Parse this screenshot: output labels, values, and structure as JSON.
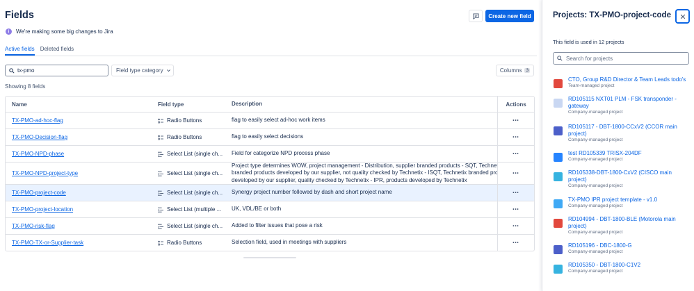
{
  "page": {
    "title": "Fields",
    "create_button": "Create new field",
    "banner": "We're making some big changes to Jira"
  },
  "tabs": [
    {
      "label": "Active fields",
      "active": true
    },
    {
      "label": "Deleted fields",
      "active": false
    }
  ],
  "filters": {
    "search_value": "tx-pmo",
    "field_type": "Field type category",
    "columns_label": "Columns",
    "columns_count": "3",
    "showing": "Showing 8 fields"
  },
  "table": {
    "headers": {
      "name": "Name",
      "type": "Field type",
      "description": "Description",
      "actions": "Actions"
    },
    "rows": [
      {
        "name": "TX-PMO-ad-hoc-flag",
        "type": "Radio Buttons",
        "icon": "radio-icon",
        "description": [
          "flag to easily select ad-hoc work items"
        ],
        "selected": false
      },
      {
        "name": "TX-PMO-Decision-flag",
        "type": "Radio Buttons",
        "icon": "radio-icon",
        "description": [
          "flag to easily select decisions"
        ],
        "selected": false
      },
      {
        "name": "TX-PMO-NPD-phase",
        "type": "Select List (single ch...",
        "icon": "select-icon",
        "description": [
          "Field for categorize NPD process phase"
        ],
        "selected": false
      },
      {
        "name": "TX-PMO-NPD-project-type",
        "type": "Select List (single ch...",
        "icon": "select-icon",
        "description": [
          "Project type determines WOW, project management - Distribution, supplier branded products - SQT, Technetix",
          "branded products developed by our supplier, not quality checked by Technetix - ISQT, Technetix branded prod",
          "developed by our supplier, quality checked by Technetix - IPR, products developed by Technetix"
        ],
        "selected": false
      },
      {
        "name": "TX-PMO-project-code",
        "type": "Select List (single ch...",
        "icon": "select-icon",
        "description": [
          "Synergy project number followed by dash and short project name"
        ],
        "selected": true
      },
      {
        "name": "TX-PMO-project-location",
        "type": "Select List (multiple ...",
        "icon": "select-icon",
        "description": [
          "UK, VDL/BE or both"
        ],
        "selected": false
      },
      {
        "name": "TX-PMO-risk-flag",
        "type": "Select List (single ch...",
        "icon": "select-icon",
        "description": [
          "Added to filter issues that pose a risk"
        ],
        "selected": false
      },
      {
        "name": "TX-PMO-TX-or-Supplier-task",
        "type": "Radio Buttons",
        "icon": "radio-icon",
        "description": [
          "Selection field, used in meetings with suppliers"
        ],
        "selected": false
      }
    ]
  },
  "panel": {
    "title": "Projects: TX-PMO-project-code",
    "info": "This field is used in 12 projects",
    "search_placeholder": "Search for projects",
    "projects": [
      {
        "name": [
          "CTO, Group R&D Director & Team Leads todo's"
        ],
        "type": "Team-managed project",
        "color": "#e2483d"
      },
      {
        "name": [
          "RD105115 NXT01 PLM - FSK transponder -",
          "gateway"
        ],
        "type": "Company-managed project",
        "color": "#c9d7f2"
      },
      {
        "name": [
          "RD105117 - DBT-1800-CCxV2 (CCOR main",
          "project)"
        ],
        "type": "Company-managed project",
        "color": "#4c5fc9"
      },
      {
        "name": [
          "test RD105339 TRISX-204DF"
        ],
        "type": "Company-managed project",
        "color": "#2684ff"
      },
      {
        "name": [
          "RD105338-DBT-1800-CxV2 (CISCO main",
          "project)"
        ],
        "type": "Company-managed project",
        "color": "#36b3e0"
      },
      {
        "name": [
          "TX-PMO IPR project template - v1.0"
        ],
        "type": "Company-managed project",
        "color": "#3fa9f5"
      },
      {
        "name": [
          "RD104994 - DBT-1800-BLE (Motorola main",
          "project)"
        ],
        "type": "Company-managed project",
        "color": "#e2483d"
      },
      {
        "name": [
          "RD105196 - DBC-1800-G"
        ],
        "type": "Company-managed project",
        "color": "#4c5fc9"
      },
      {
        "name": [
          "RD105350 - DBT-1800-C1V2"
        ],
        "type": "Company-managed project",
        "color": "#36b3e0"
      }
    ]
  }
}
